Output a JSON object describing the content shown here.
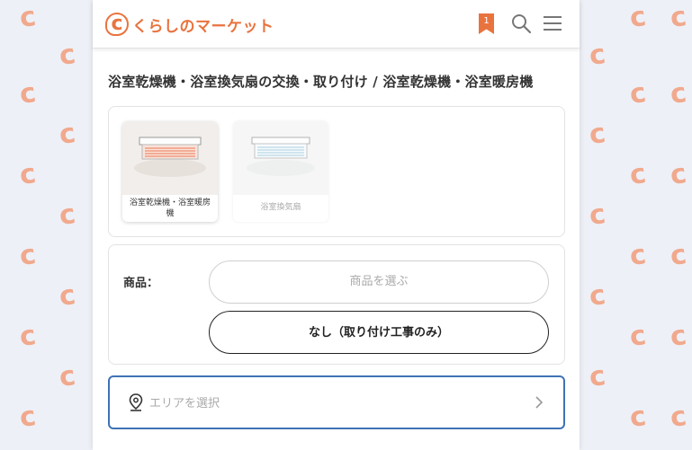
{
  "header": {
    "brand_mark": "c",
    "brand_name": "くらしのマーケット",
    "bookmark_count": "1",
    "icons": [
      "bookmark-icon",
      "search-icon",
      "menu-icon"
    ]
  },
  "page_title": "浴室乾燥機・浴室換気扇の交換・取り付け / 浴室乾燥機・浴室暖房機",
  "categories": [
    {
      "label": "浴室乾燥機・浴室暖房機",
      "selected": true
    },
    {
      "label": "浴室換気扇",
      "selected": false
    }
  ],
  "product": {
    "label": "商品：",
    "select_button": "商品を選ぶ",
    "none_button": "なし（取り付け工事のみ）"
  },
  "area": {
    "placeholder": "エリアを選択",
    "icon": "location-pin-icon"
  },
  "colors": {
    "brand": "#e9733f",
    "focus_border": "#3f72b5",
    "background": "#eef0f7"
  }
}
